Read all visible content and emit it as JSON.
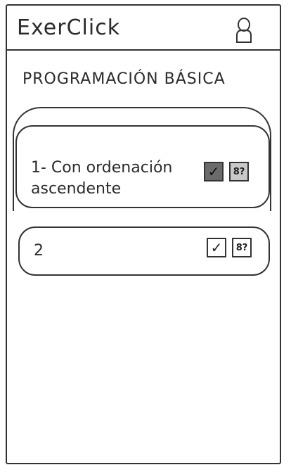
{
  "header": {
    "app_title": "ExerClick",
    "user_icon": "user-icon"
  },
  "section": {
    "title": "PROGRAMACIÓN BÁSICA"
  },
  "exercises": [
    {
      "label": "1- Con ordenación ascendente",
      "completed": true,
      "hint_active": true,
      "check_icon": "check-icon",
      "hint_icon": "hint-icon",
      "check_symbol": "✓",
      "hint_symbol": "8?"
    },
    {
      "label": "2",
      "completed": false,
      "hint_active": false,
      "check_icon": "check-icon",
      "hint_icon": "hint-icon",
      "check_symbol": "✓",
      "hint_symbol": "8?"
    }
  ]
}
